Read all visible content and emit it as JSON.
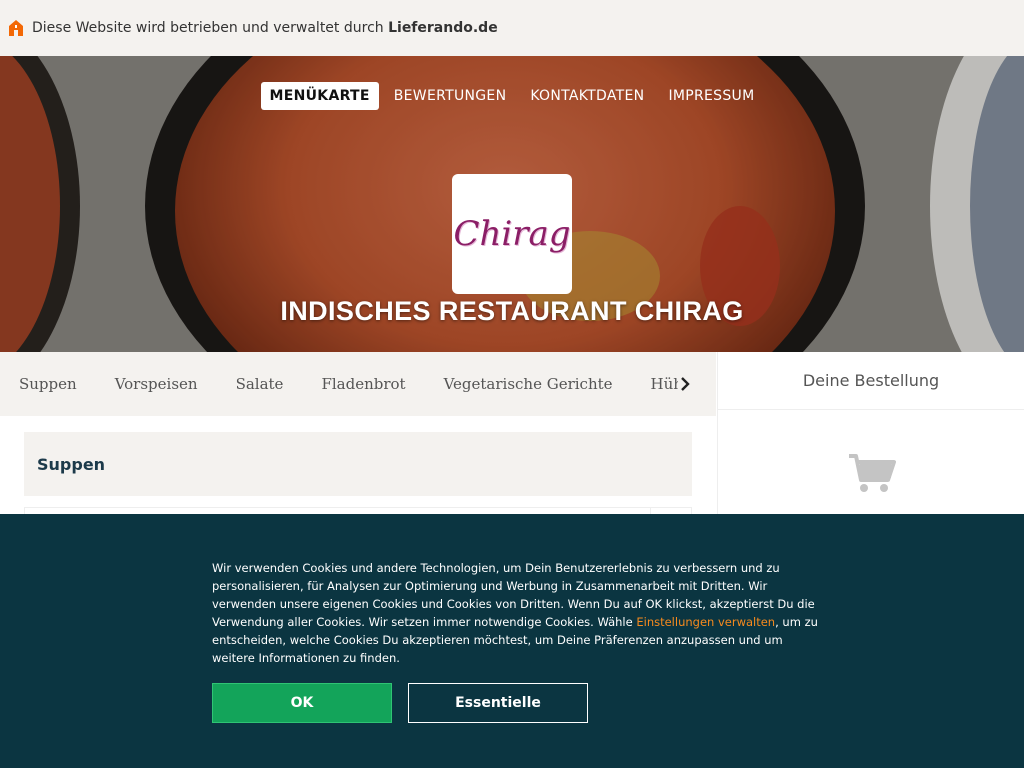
{
  "topbar": {
    "text": "Diese Website wird betrieben und verwaltet durch",
    "brand": "Lieferando.de",
    "icon": "home-icon",
    "icon_color": "#f36805"
  },
  "nav": {
    "items": [
      "MENÜKARTE",
      "BEWERTUNGEN",
      "KONTAKTDATEN",
      "IMPRESSUM"
    ],
    "active_index": 0
  },
  "hero": {
    "logo_text": "Chirag",
    "title": "INDISCHES RESTAURANT CHIRAG"
  },
  "categories": {
    "items": [
      "Suppen",
      "Vorspeisen",
      "Salate",
      "Fladenbrot",
      "Vegetarische Gerichte",
      "Hühnerfle"
    ],
    "next_icon": "chevron-right-icon"
  },
  "order": {
    "title": "Deine Bestellung",
    "icon": "cart-icon"
  },
  "menu": {
    "section_title": "Suppen"
  },
  "cookie": {
    "text_before_link": "Wir verwenden Cookies und andere Technologien, um Dein Benutzererlebnis zu verbessern und zu personalisieren, für Analysen zur Optimierung und Werbung in Zusammenarbeit mit Dritten. Wir verwenden unsere eigenen Cookies und Cookies von Dritten. Wenn Du auf OK klickst, akzeptierst Du die Verwendung aller Cookies. Wir setzen immer notwendige Cookies. Wähle",
    "link": "Einstellungen verwalten",
    "text_after_link": ", um zu entscheiden, welche Cookies Du akzeptieren möchtest, um Deine Präferenzen anzupassen und um weitere Informationen zu finden.",
    "ok_label": "OK",
    "essential_label": "Essentielle",
    "background": "#0b3541",
    "ok_color": "#13a45a",
    "link_color": "#f68a1e"
  }
}
